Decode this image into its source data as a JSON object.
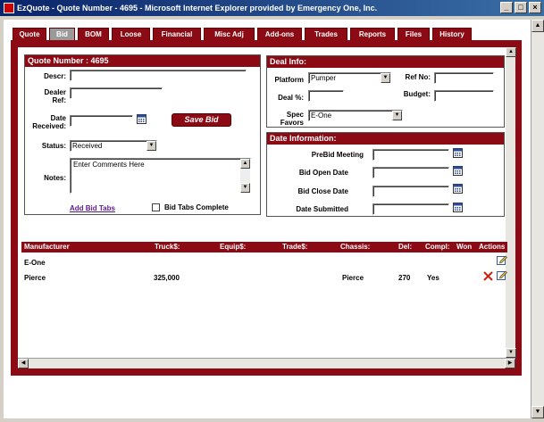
{
  "window": {
    "title": "EzQuote - Quote Number - 4695 - Microsoft Internet Explorer provided by Emergency One, Inc.",
    "minimize": "_",
    "maximize": "□",
    "close": "×"
  },
  "tabs": [
    {
      "label": "Quote"
    },
    {
      "label": "Bid"
    },
    {
      "label": "BOM"
    },
    {
      "label": "Loose"
    },
    {
      "label": "Financial"
    },
    {
      "label": "Misc Adj"
    },
    {
      "label": "Add-ons"
    },
    {
      "label": "Trades"
    },
    {
      "label": "Reports"
    },
    {
      "label": "Files"
    },
    {
      "label": "History"
    }
  ],
  "active_tab": "Bid",
  "quote_panel": {
    "title": "Quote Number : 4695",
    "descr_label": "Descr:",
    "descr_value": "",
    "dealer_ref_label_1": "Dealer",
    "dealer_ref_label_2": "Ref:",
    "dealer_ref_value": "",
    "date_received_label_1": "Date",
    "date_received_label_2": "Received:",
    "date_received_value": "",
    "save_bid": "Save Bid",
    "status_label": "Status:",
    "status_value": "Received",
    "notes_label": "Notes:",
    "notes_value": "Enter Comments Here",
    "add_bid_tabs": "Add Bid Tabs",
    "bid_tabs_complete": "Bid Tabs Complete"
  },
  "deal_panel": {
    "title": "Deal Info:",
    "platform_label": "Platform",
    "platform_value": "Pumper",
    "ref_no_label": "Ref No:",
    "ref_no_value": "",
    "deal_pct_label": "Deal %:",
    "deal_pct_value": "",
    "budget_label": "Budget:",
    "budget_value": "",
    "spec_favors_label_1": "Spec",
    "spec_favors_label_2": "Favors",
    "spec_favors_value": "E-One"
  },
  "date_panel": {
    "title": "Date Information:",
    "prebid_label": "PreBid Meeting",
    "prebid_value": "",
    "bid_open_label": "Bid Open Date",
    "bid_open_value": "",
    "bid_close_label": "Bid Close Date",
    "bid_close_value": "",
    "date_submitted_label": "Date Submitted",
    "date_submitted_value": ""
  },
  "bid_table": {
    "headers": {
      "manufacturer": "Manufacturer",
      "truck": "Truck$:",
      "equip": "Equip$:",
      "trade": "Trade$:",
      "chassis": "Chassis:",
      "del": "Del:",
      "compl": "Compl:",
      "won": "Won",
      "actions": "Actions"
    },
    "rows": [
      {
        "manufacturer": "E-One",
        "truck": "",
        "equip": "",
        "trade": "",
        "chassis": "",
        "del": "",
        "compl": "",
        "won": ""
      },
      {
        "manufacturer": "Pierce",
        "truck": "325,000",
        "equip": "",
        "trade": "",
        "chassis": "Pierce",
        "del": "270",
        "compl": "Yes",
        "won": ""
      }
    ]
  },
  "colors": {
    "brand": "#8b0a14",
    "title_bar": "#0a246a"
  }
}
